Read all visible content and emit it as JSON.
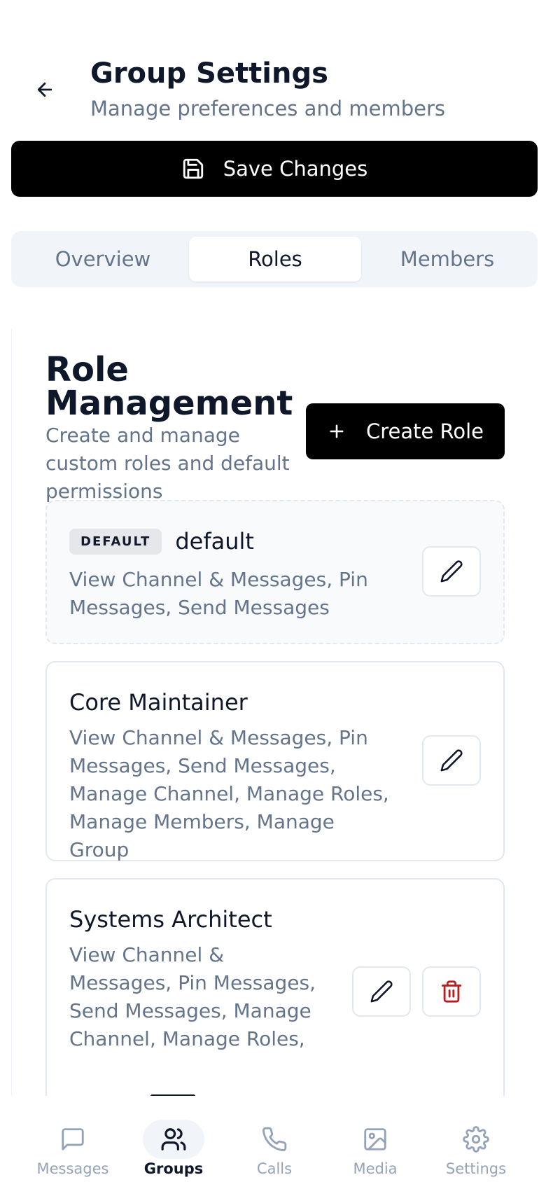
{
  "header": {
    "title": "Group Settings",
    "subtitle": "Manage preferences and members",
    "back_icon": "arrow-left-icon"
  },
  "save_button": {
    "label": "Save Changes",
    "icon": "save-icon"
  },
  "tabs": [
    {
      "label": "Overview",
      "active": false
    },
    {
      "label": "Roles",
      "active": true
    },
    {
      "label": "Members",
      "active": false
    }
  ],
  "section": {
    "title": "Role Management",
    "description": "Create and manage custom roles and default permissions",
    "create_button": {
      "label": "Create Role",
      "icon": "plus-icon"
    }
  },
  "roles": [
    {
      "badge": "DEFAULT",
      "name": "default",
      "permissions": "View Channel & Messages, Pin Messages, Send Messages",
      "actions": [
        "edit"
      ]
    },
    {
      "name": "Core Maintainer",
      "permissions": "View Channel & Messages, Pin Messages, Send Messages, Manage Channel, Manage Roles, Manage Members, Manage Group",
      "actions": [
        "edit"
      ]
    },
    {
      "name": "Systems Architect",
      "permissions": "View Channel & Messages, Pin Messages, Send Messages, Manage Channel, Manage Roles,",
      "actions": [
        "edit",
        "delete"
      ]
    }
  ],
  "bottom_nav": [
    {
      "label": "Messages",
      "icon": "message-square-icon",
      "active": false
    },
    {
      "label": "Groups",
      "icon": "users-icon",
      "active": true
    },
    {
      "label": "Calls",
      "icon": "phone-icon",
      "active": false
    },
    {
      "label": "Media",
      "icon": "image-icon",
      "active": false
    },
    {
      "label": "Settings",
      "icon": "gear-icon",
      "active": false
    }
  ],
  "colors": {
    "primary": "#000000",
    "text": "#0f172a",
    "muted": "#64748b",
    "border": "#e2e8f0",
    "danger": "#b91c1c"
  }
}
